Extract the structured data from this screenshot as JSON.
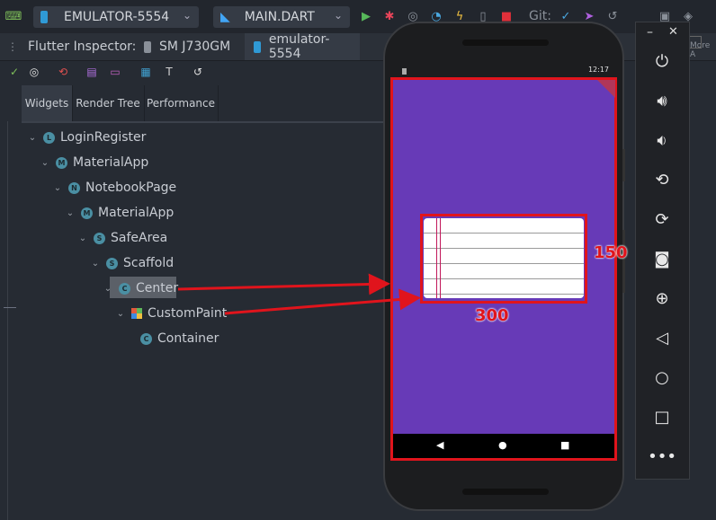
{
  "toolbar": {
    "device": "EMULATOR-5554",
    "file": "MAIN.DART",
    "git_label": "Git:"
  },
  "tabs": {
    "inspector": "Flutter Inspector:",
    "device1": "SM J730GM",
    "device2": "emulator-5554",
    "more": "More A"
  },
  "subtabs": [
    "Widgets",
    "Render Tree",
    "Performance"
  ],
  "tree": [
    {
      "label": "LoginRegister",
      "icon": "L"
    },
    {
      "label": "MaterialApp",
      "icon": "M"
    },
    {
      "label": "NotebookPage",
      "icon": "N"
    },
    {
      "label": "MaterialApp",
      "icon": "M"
    },
    {
      "label": "SafeArea",
      "icon": "S"
    },
    {
      "label": "Scaffold",
      "icon": "S"
    },
    {
      "label": "Center",
      "icon": "C"
    },
    {
      "label": "CustomPaint",
      "icon": "paint"
    },
    {
      "label": "Container",
      "icon": "C"
    }
  ],
  "phone": {
    "time": "12:17",
    "canvas_width_label": "300",
    "canvas_height_label": "150",
    "nav": {
      "back": "◀",
      "home": "●",
      "recents": "■"
    }
  },
  "colors": {
    "screen_bg": "#673ab7",
    "highlight": "#e0141c",
    "ide_bg": "#262b33"
  },
  "side_panel": {
    "icons": [
      "power-icon",
      "volume-up-icon",
      "volume-down-icon",
      "rotate-left-icon",
      "rotate-right-icon",
      "camera-icon",
      "zoom-icon",
      "back-icon",
      "home-icon",
      "overview-icon",
      "more-icon"
    ]
  }
}
